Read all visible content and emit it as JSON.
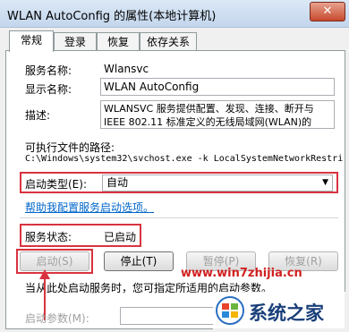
{
  "window": {
    "title": "WLAN AutoConfig 的属性(本地计算机)",
    "close_label": "✕"
  },
  "tabs": [
    {
      "label": "常规",
      "active": true
    },
    {
      "label": "登录"
    },
    {
      "label": "恢复"
    },
    {
      "label": "依存关系"
    }
  ],
  "general": {
    "service_name_label": "服务名称:",
    "service_name_value": "Wlansvc",
    "display_name_label": "显示名称:",
    "display_name_value": "WLAN AutoConfig",
    "description_label": "描述:",
    "description_line1": "WLANSVC 服务提供配置、发现、连接、断开与",
    "description_line2": "IEEE 802.11 标准定义的无线局域网(WLAN)的",
    "exe_path_label": "可执行文件的路径:",
    "exe_path_value": "C:\\Windows\\system32\\svchost.exe -k LocalSystemNetworkRestric",
    "startup_type_label": "启动类型(E):",
    "startup_type_value": "自动",
    "help_link": "帮助我配置服务启动选项。",
    "status_label": "服务状态:",
    "status_value": "已启动",
    "buttons": {
      "start": "启动(S)",
      "stop": "停止(T)",
      "pause": "暂停(P)",
      "resume": "恢复(R)"
    },
    "start_hint": "当从此处启动服务时，您可指定所适用的启动参数。",
    "start_params_label": "启动参数(M):"
  },
  "watermark": {
    "url": "www.win7zhijia.cn",
    "brand": "系统之家"
  },
  "colors": {
    "highlight_box": "#d9333f",
    "link": "#0066cc",
    "watermark_url": "#d02020"
  }
}
